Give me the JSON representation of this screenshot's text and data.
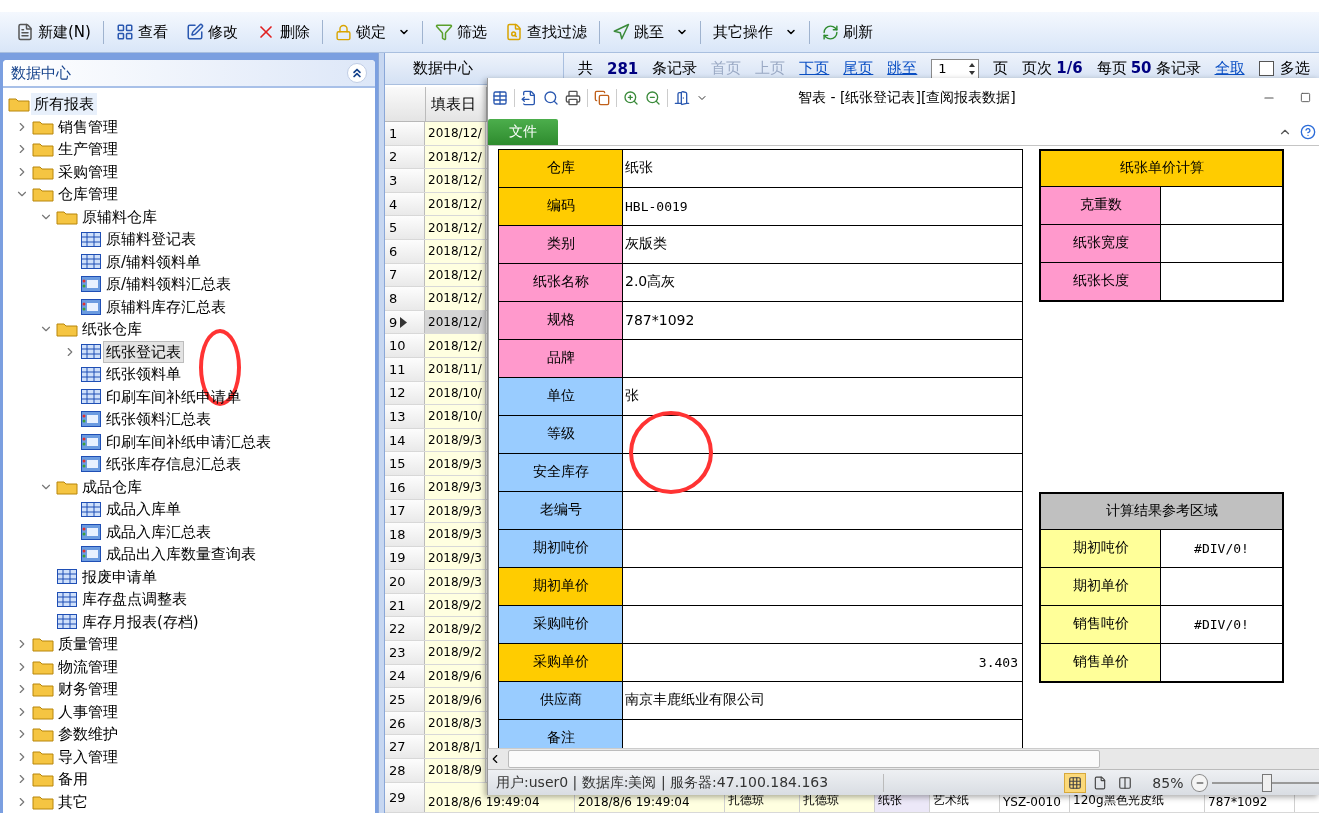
{
  "toolbar": {
    "groups": [
      [
        {
          "label": "新建(N)",
          "dropdown": false
        }
      ],
      [
        {
          "label": "查看",
          "dropdown": false
        },
        {
          "label": "修改",
          "dropdown": false
        },
        {
          "label": "删除",
          "dropdown": false
        }
      ],
      [
        {
          "label": "锁定",
          "dropdown": true
        }
      ],
      [
        {
          "label": "筛选",
          "dropdown": false
        },
        {
          "label": "查找过滤",
          "dropdown": false
        }
      ],
      [
        {
          "label": "跳至",
          "dropdown": true
        }
      ],
      [
        {
          "label": "其它操作",
          "dropdown": true
        }
      ],
      [
        {
          "label": "刷新",
          "dropdown": false
        }
      ]
    ]
  },
  "sidebar": {
    "title": "数据中心",
    "tree": [
      {
        "label": "所有报表",
        "kind": "folder",
        "selected": false,
        "children": [
          {
            "label": "销售管理",
            "kind": "folder",
            "expanded": false,
            "selected": false
          },
          {
            "label": "生产管理",
            "kind": "folder",
            "expanded": false,
            "selected": false
          },
          {
            "label": "采购管理",
            "kind": "folder",
            "expanded": false,
            "selected": false
          },
          {
            "label": "仓库管理",
            "kind": "folder",
            "expanded": true,
            "selected": false,
            "children": [
              {
                "label": "原辅料仓库",
                "kind": "folder",
                "expanded": true,
                "selected": false,
                "children": [
                  {
                    "label": "原辅料登记表",
                    "kind": "table",
                    "selected": false
                  },
                  {
                    "label": "原/辅料领料单",
                    "kind": "table",
                    "selected": false
                  },
                  {
                    "label": "原/辅料领料汇总表",
                    "kind": "report",
                    "selected": false
                  },
                  {
                    "label": "原辅料库存汇总表",
                    "kind": "report",
                    "selected": false
                  }
                ]
              },
              {
                "label": "纸张仓库",
                "kind": "folder",
                "expanded": true,
                "selected": false,
                "children": [
                  {
                    "label": "纸张登记表",
                    "kind": "table",
                    "expanded": false,
                    "selected": true
                  },
                  {
                    "label": "纸张领料单",
                    "kind": "table",
                    "selected": false
                  },
                  {
                    "label": "印刷车间补纸申请单",
                    "kind": "table",
                    "selected": false
                  },
                  {
                    "label": "纸张领料汇总表",
                    "kind": "report",
                    "selected": false
                  },
                  {
                    "label": "印刷车间补纸申请汇总表",
                    "kind": "report",
                    "selected": false
                  },
                  {
                    "label": "纸张库存信息汇总表",
                    "kind": "report",
                    "selected": false
                  }
                ]
              },
              {
                "label": "成品仓库",
                "kind": "folder",
                "expanded": true,
                "selected": false,
                "children": [
                  {
                    "label": "成品入库单",
                    "kind": "table",
                    "selected": false
                  },
                  {
                    "label": "成品入库汇总表",
                    "kind": "report",
                    "selected": false
                  },
                  {
                    "label": "成品出入库数量查询表",
                    "kind": "report",
                    "selected": false
                  }
                ]
              },
              {
                "label": "报废申请单",
                "kind": "table",
                "selected": false
              },
              {
                "label": "库存盘点调整表",
                "kind": "table",
                "selected": false
              },
              {
                "label": "库存月报表(存档)",
                "kind": "table",
                "selected": false
              }
            ]
          },
          {
            "label": "质量管理",
            "kind": "folder",
            "expanded": false,
            "selected": false
          },
          {
            "label": "物流管理",
            "kind": "folder",
            "expanded": false,
            "selected": false
          },
          {
            "label": "财务管理",
            "kind": "folder",
            "expanded": false,
            "selected": false
          },
          {
            "label": "人事管理",
            "kind": "folder",
            "expanded": false,
            "selected": false
          },
          {
            "label": "参数维护",
            "kind": "folder",
            "expanded": false,
            "selected": false
          },
          {
            "label": "导入管理",
            "kind": "folder",
            "expanded": false,
            "selected": false
          },
          {
            "label": "备用",
            "kind": "folder",
            "expanded": false,
            "selected": false
          },
          {
            "label": "其它",
            "kind": "folder",
            "expanded": false,
            "selected": false
          }
        ]
      }
    ]
  },
  "grid": {
    "tab": "数据中心",
    "pager": {
      "total_label": "共",
      "total": "281",
      "records_label": "条记录",
      "nav": [
        {
          "label": "首页",
          "disabled": true
        },
        {
          "label": "上页",
          "disabled": true
        },
        {
          "label": "下页",
          "disabled": false
        },
        {
          "label": "尾页",
          "disabled": false
        }
      ],
      "jump_label": "跳至",
      "page_value": "1",
      "page_label": "页",
      "page_info_label": "页次",
      "page_info": "1/6",
      "per_page_label": "每页",
      "per_page": "50",
      "per_page_unit": "条记录",
      "select_all": "全取",
      "multi_select": {
        "label": "多选",
        "checked": false
      }
    },
    "columns": [
      "填表日"
    ],
    "rows": [
      {
        "number": "1",
        "selected": false,
        "cells": [
          "2018/12/"
        ]
      },
      {
        "number": "2",
        "selected": false,
        "cells": [
          "2018/12/"
        ]
      },
      {
        "number": "3",
        "selected": false,
        "cells": [
          "2018/12/"
        ]
      },
      {
        "number": "4",
        "selected": false,
        "cells": [
          "2018/12/"
        ]
      },
      {
        "number": "5",
        "selected": false,
        "cells": [
          "2018/12/"
        ]
      },
      {
        "number": "6",
        "selected": false,
        "cells": [
          "2018/12/"
        ]
      },
      {
        "number": "7",
        "selected": false,
        "cells": [
          "2018/12/"
        ]
      },
      {
        "number": "8",
        "selected": false,
        "cells": [
          "2018/12/"
        ]
      },
      {
        "number": "9",
        "selected": true,
        "cells": [
          "2018/12/"
        ]
      },
      {
        "number": "10",
        "selected": false,
        "cells": [
          "2018/12/"
        ]
      },
      {
        "number": "11",
        "selected": false,
        "cells": [
          "2018/11/"
        ]
      },
      {
        "number": "12",
        "selected": false,
        "cells": [
          "2018/10/"
        ]
      },
      {
        "number": "13",
        "selected": false,
        "cells": [
          "2018/10/"
        ]
      },
      {
        "number": "14",
        "selected": false,
        "cells": [
          "2018/9/3"
        ]
      },
      {
        "number": "15",
        "selected": false,
        "cells": [
          "2018/9/3"
        ]
      },
      {
        "number": "16",
        "selected": false,
        "cells": [
          "2018/9/3"
        ]
      },
      {
        "number": "17",
        "selected": false,
        "cells": [
          "2018/9/3"
        ]
      },
      {
        "number": "18",
        "selected": false,
        "cells": [
          "2018/9/3"
        ]
      },
      {
        "number": "19",
        "selected": false,
        "cells": [
          "2018/9/3"
        ]
      },
      {
        "number": "20",
        "selected": false,
        "cells": [
          "2018/9/3"
        ]
      },
      {
        "number": "21",
        "selected": false,
        "cells": [
          "2018/9/2"
        ]
      },
      {
        "number": "22",
        "selected": false,
        "cells": [
          "2018/9/2"
        ]
      },
      {
        "number": "23",
        "selected": false,
        "cells": [
          "2018/9/2"
        ]
      },
      {
        "number": "24",
        "selected": false,
        "cells": [
          "2018/9/6"
        ]
      },
      {
        "number": "25",
        "selected": false,
        "cells": [
          "2018/9/6"
        ]
      },
      {
        "number": "26",
        "selected": false,
        "cells": [
          "2018/8/3"
        ]
      },
      {
        "number": "27",
        "selected": false,
        "cells": [
          "2018/8/1"
        ]
      },
      {
        "number": "28",
        "selected": false,
        "cells": [
          "2018/8/9"
        ]
      },
      {
        "number": "29",
        "selected": false,
        "cells": [
          "2018/8/6 19:49:04",
          "2018/8/6 19:49:04",
          "扎德琼",
          "扎德琼",
          "纸张",
          "艺术纸",
          "YSZ-0010",
          "120g黑色光皮纸",
          "787*1092"
        ]
      }
    ]
  },
  "dialog": {
    "title": "智表 - [纸张登记表][查阅报表数据]",
    "file_tab": "文件",
    "form": [
      {
        "label": "仓库",
        "color": "#ffcc00",
        "value": "纸张",
        "kind": "text"
      },
      {
        "label": "编码",
        "color": "#ffcc00",
        "value": "HBL-0019",
        "kind": "code"
      },
      {
        "label": "类别",
        "color": "#ff99cc",
        "value": "灰版类",
        "kind": "text"
      },
      {
        "label": "纸张名称",
        "color": "#ff99cc",
        "value": "2.0高灰",
        "kind": "text"
      },
      {
        "label": "规格",
        "color": "#ff99cc",
        "value": "787*1092",
        "kind": "text"
      },
      {
        "label": "品牌",
        "color": "#ff99cc",
        "kind": "text"
      },
      {
        "label": "单位",
        "color": "#99ccff",
        "value": "张",
        "kind": "text"
      },
      {
        "label": "等级",
        "color": "#99ccff",
        "kind": "text"
      },
      {
        "label": "安全库存",
        "color": "#99ccff",
        "kind": "text"
      },
      {
        "label": "老编号",
        "color": "#99ccff",
        "kind": "text"
      },
      {
        "label": "期初吨价",
        "color": "#99ccff",
        "kind": "text"
      },
      {
        "label": "期初单价",
        "color": "#ffcc00",
        "kind": "text"
      },
      {
        "label": "采购吨价",
        "color": "#99ccff",
        "kind": "text"
      },
      {
        "label": "采购单价",
        "color": "#ffcc00",
        "value": "3.403",
        "kind": "number"
      },
      {
        "label": "供应商",
        "color": "#99ccff",
        "value": "南京丰鹿纸业有限公司",
        "kind": "text"
      },
      {
        "label": "备注",
        "color": "#99ccff",
        "kind": "text"
      }
    ],
    "calc_tables": [
      {
        "title": "纸张单价计算",
        "color": "#ffcc00",
        "rows": [
          {
            "label": "克重数",
            "color": "#ff99cc"
          },
          {
            "label": "纸张宽度",
            "color": "#ff99cc"
          },
          {
            "label": "纸张长度",
            "color": "#ff99cc"
          }
        ]
      },
      {
        "title": "计算结果参考区域",
        "color": "#c0c0c0",
        "rows": [
          {
            "label": "期初吨价",
            "color": "#ffff99",
            "value": "#DIV/0!"
          },
          {
            "label": "期初单价",
            "color": "#ffff99"
          },
          {
            "label": "销售吨价",
            "color": "#ffff99",
            "value": "#DIV/0!"
          },
          {
            "label": "销售单价",
            "color": "#ffff99"
          }
        ]
      }
    ],
    "status": {
      "text": "用户:user0 | 数据库:美阅 | 服务器:47.100.184.163",
      "views": [
        {
          "selected": true
        },
        {
          "selected": false
        },
        {
          "selected": false
        }
      ],
      "zoom": "85%",
      "zoom_slider": {
        "level": 0.5
      }
    }
  }
}
